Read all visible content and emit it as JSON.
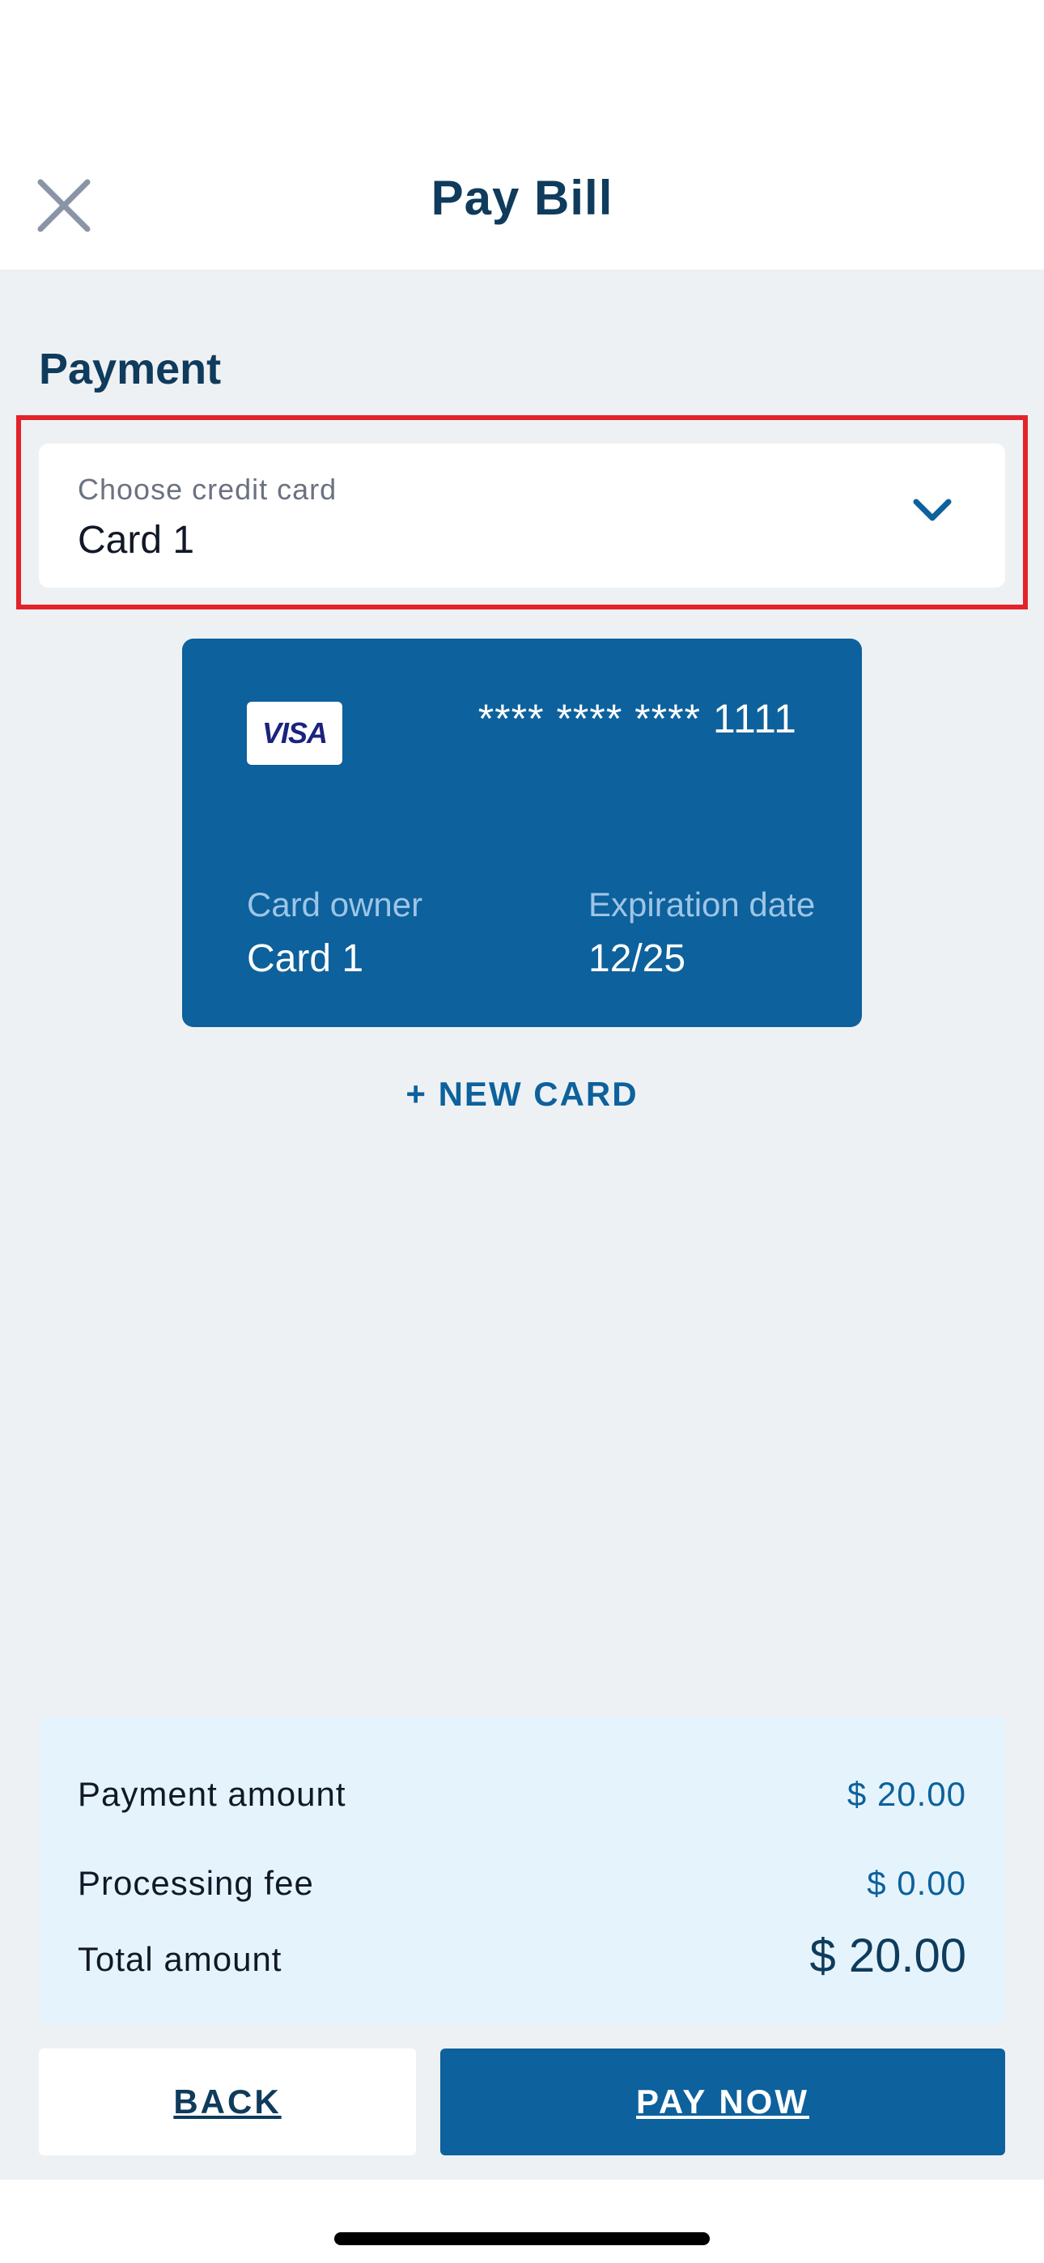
{
  "header": {
    "title": "Pay Bill",
    "close_icon": "close-icon"
  },
  "payment": {
    "heading": "Payment",
    "select": {
      "label": "Choose credit card",
      "value": "Card 1",
      "icon": "chevron-down-icon"
    }
  },
  "card": {
    "brand": "VISA",
    "number": "**** **** **** 1111",
    "owner_label": "Card owner",
    "owner_value": "Card 1",
    "expiry_label": "Expiration date",
    "expiry_value": "12/25"
  },
  "new_card_label": "+ NEW CARD",
  "summary": {
    "payment_amount_label": "Payment amount",
    "payment_amount_value": "$ 20.00",
    "processing_fee_label": "Processing fee",
    "processing_fee_value": "$ 0.00",
    "total_label": "Total amount",
    "total_value": "$ 20.00"
  },
  "actions": {
    "back_label": "BACK",
    "pay_label": "PAY NOW"
  },
  "colors": {
    "primary": "#0d619c",
    "heading": "#0f3b5c",
    "background": "#eef1f4",
    "summary_bg": "#e5f4fc",
    "highlight": "#e2242a"
  }
}
